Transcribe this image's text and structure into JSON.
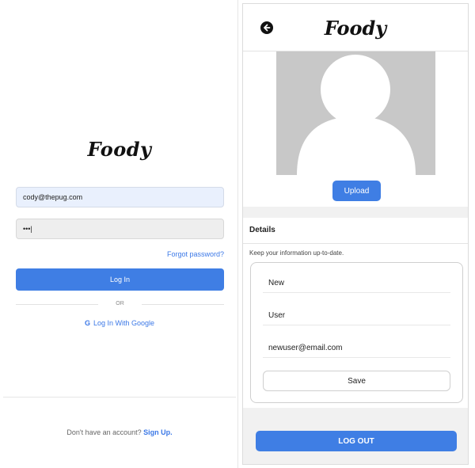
{
  "login": {
    "logo": "Foody",
    "email_value": "cody@thepug.com",
    "password_value": "•••|",
    "forgot_label": "Forgot password?",
    "login_label": "Log In",
    "or_label": "OR",
    "google_icon": "G",
    "google_label": "Log In With Google",
    "signup_prompt": "Don't have an account?",
    "signup_link": "Sign Up."
  },
  "profile": {
    "back_icon": "arrow-left-circle",
    "logo": "Foody",
    "upload_label": "Upload",
    "details_title": "Details",
    "details_subtitle": "Keep your information up-to-date.",
    "first_name": "New",
    "last_name": "User",
    "email": "newuser@email.com",
    "save_label": "Save",
    "logout_label": "LOG OUT"
  },
  "colors": {
    "accent": "#3f7ee4",
    "link": "#3b78e7",
    "avatar_bg": "#c8c8c8",
    "email_input_bg": "#e9f0fd"
  }
}
